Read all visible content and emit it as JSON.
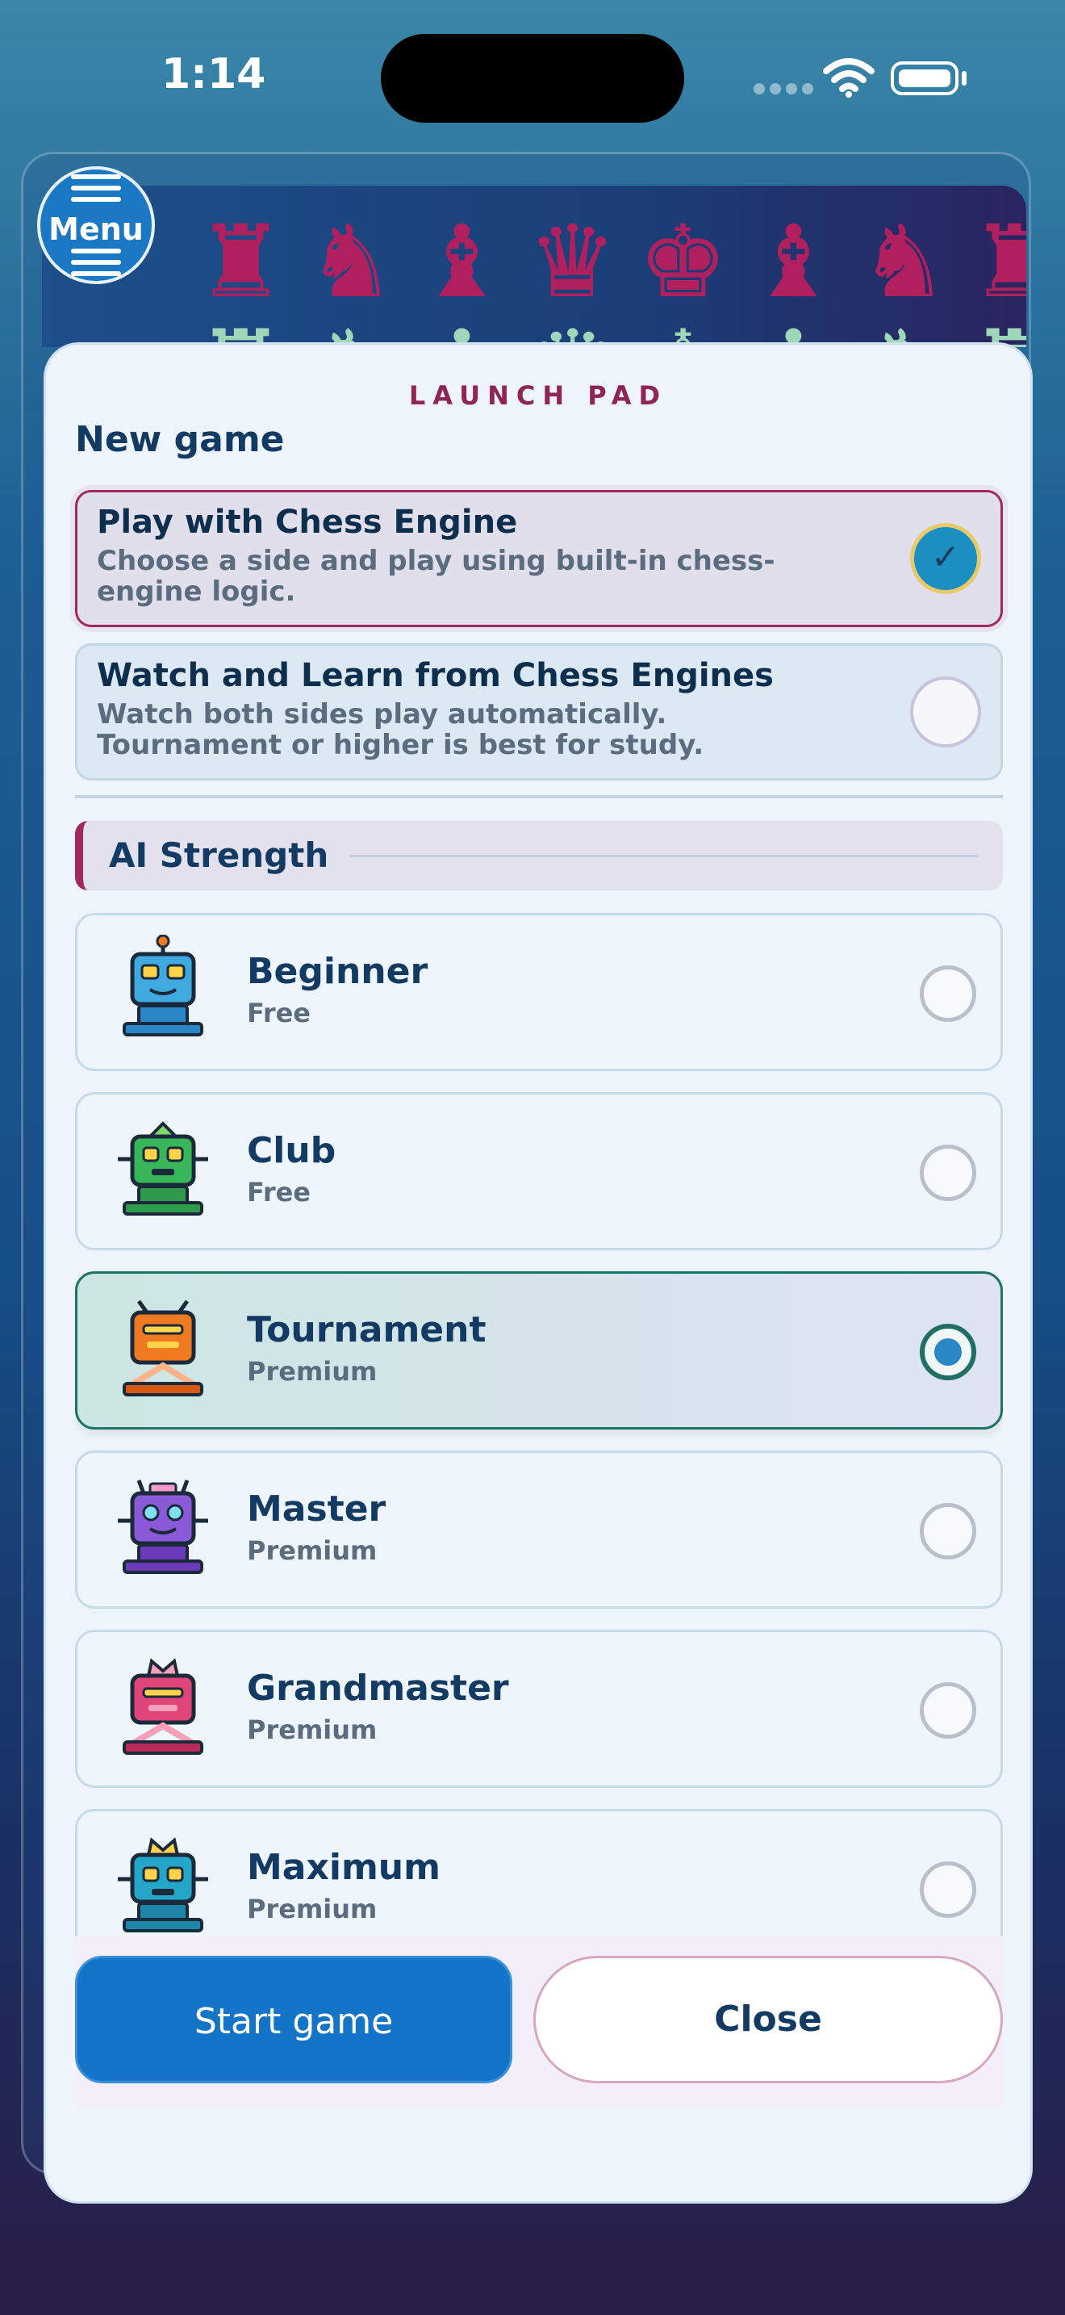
{
  "status_bar": {
    "time": "1:14",
    "wifi_icon": "wifi-icon",
    "battery_icon": "battery-icon"
  },
  "board": {
    "menu_label": "Menu",
    "piece_color": "#b0205e"
  },
  "sheet": {
    "eyebrow": "LAUNCH PAD",
    "heading": "New game",
    "modes": [
      {
        "title": "Play with Chess Engine",
        "description": "Choose a side and play using built-in chess-engine logic.",
        "selected": true
      },
      {
        "title": "Watch and Learn from Chess Engines",
        "description": "Watch both sides play automatically. Tournament or higher is best for study.",
        "selected": false
      }
    ],
    "section_title": "AI Strength",
    "levels": [
      {
        "name": "Beginner",
        "tier": "Free",
        "icon": "beginner-robot-icon",
        "color": "#3fa9e0",
        "selected": false
      },
      {
        "name": "Club",
        "tier": "Free",
        "icon": "club-robot-icon",
        "color": "#38b65a",
        "selected": false
      },
      {
        "name": "Tournament",
        "tier": "Premium",
        "icon": "tournament-robot-icon",
        "color": "#f07a22",
        "selected": true
      },
      {
        "name": "Master",
        "tier": "Premium",
        "icon": "master-robot-icon",
        "color": "#8a5ad8",
        "selected": false
      },
      {
        "name": "Grandmaster",
        "tier": "Premium",
        "icon": "grandmaster-robot-icon",
        "color": "#e0457a",
        "selected": false
      },
      {
        "name": "Maximum",
        "tier": "Premium",
        "icon": "maximum-robot-icon",
        "color": "#24a6c8",
        "selected": false
      }
    ],
    "start_label": "Start game",
    "close_label": "Close"
  }
}
